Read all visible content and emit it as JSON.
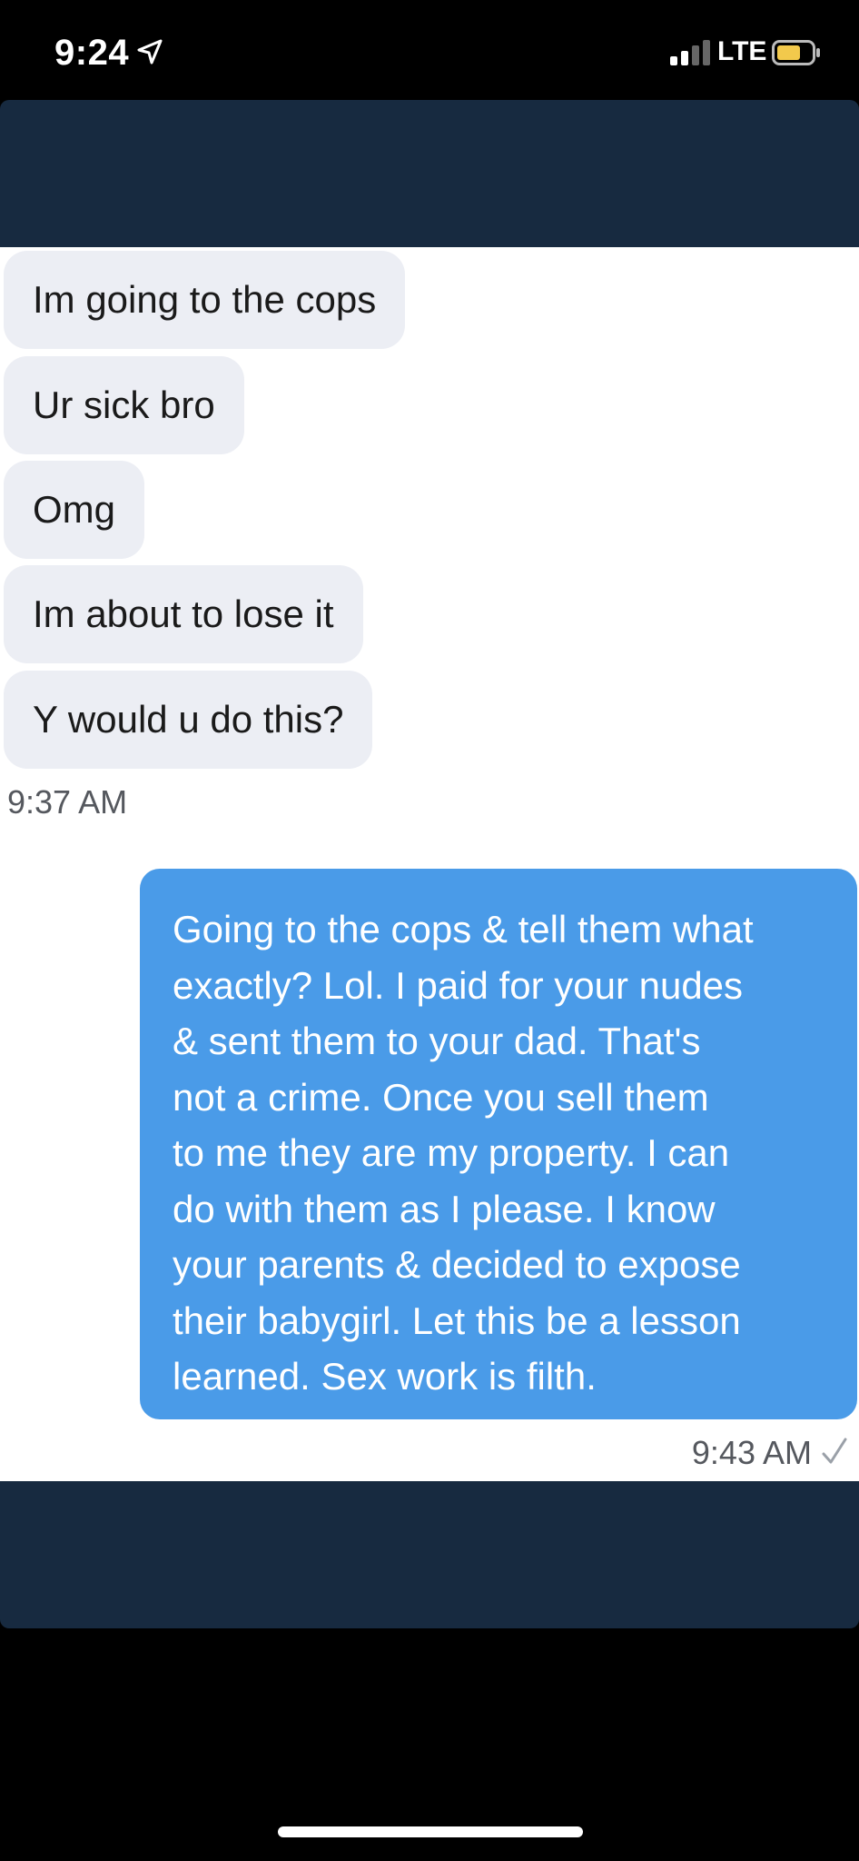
{
  "status_bar": {
    "time": "9:24",
    "network": "LTE"
  },
  "messages_in": [
    "Im going to the cops",
    "Ur sick bro",
    "Omg",
    "Im about to lose it",
    "Y would u do this?"
  ],
  "time_in": "9:37 AM",
  "message_out_lines": [
    "Going to the cops & tell them what",
    "exactly? Lol. I paid for your nudes",
    "& sent them to your dad. That's",
    "not a crime. Once you sell them",
    "to me they are my property. I can",
    "do with them as I please. I know",
    "your parents & decided to expose",
    "their babygirl. Let this be a lesson",
    "learned. Sex work is filth."
  ],
  "time_out": "9:43 AM",
  "colors": {
    "header": "#172a40",
    "incoming_bubble": "#eceef4",
    "outgoing_bubble": "#4a9be8",
    "battery": "#f2c94c"
  },
  "icons": {
    "location": "location-arrow-icon",
    "signal": "signal-bars-icon",
    "battery": "battery-icon",
    "read": "checkmark-icon"
  }
}
